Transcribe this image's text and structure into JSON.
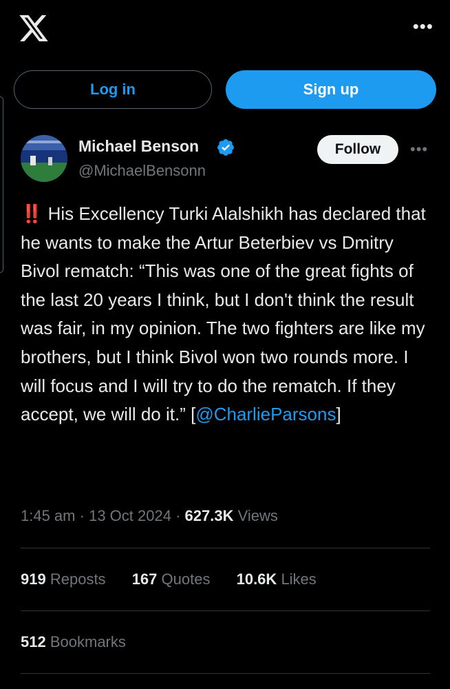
{
  "header": {
    "logo_icon": "x-logo-icon",
    "more_icon": "ellipsis-icon",
    "more_label": "•••"
  },
  "auth": {
    "login_label": "Log in",
    "signup_label": "Sign up"
  },
  "post": {
    "author_name": "Michael Benson",
    "author_handle": "@MichaelBensonn",
    "verified_icon": "verified-badge-icon",
    "follow_label": "Follow",
    "more_label": "•••",
    "emoji": "‼️",
    "text_main": " His Excellency Turki Alalshikh has declared that he wants to make the Artur Beterbiev vs Dmitry Bivol rematch: “This was one of the great fights of the last 20 years I think, but I don't think the result was fair, in my opinion. The two fighters are like my brothers, but I think Bivol won two rounds more. I will focus and I will try to do the rematch. If they accept, we will do it.” [",
    "mention": "@CharlieParsons",
    "text_end": "]",
    "time": "1:45 am",
    "date": "13 Oct 2024",
    "views_count": "627.3K",
    "views_label": "Views"
  },
  "stats": {
    "reposts_count": "919",
    "reposts_label": "Reposts",
    "quotes_count": "167",
    "quotes_label": "Quotes",
    "likes_count": "10.6K",
    "likes_label": "Likes",
    "bookmarks_count": "512",
    "bookmarks_label": "Bookmarks"
  },
  "colors": {
    "background": "#000000",
    "accent": "#1d9bf0",
    "text": "#e7e9ea",
    "muted": "#71767b",
    "alert": "#e0245e"
  }
}
